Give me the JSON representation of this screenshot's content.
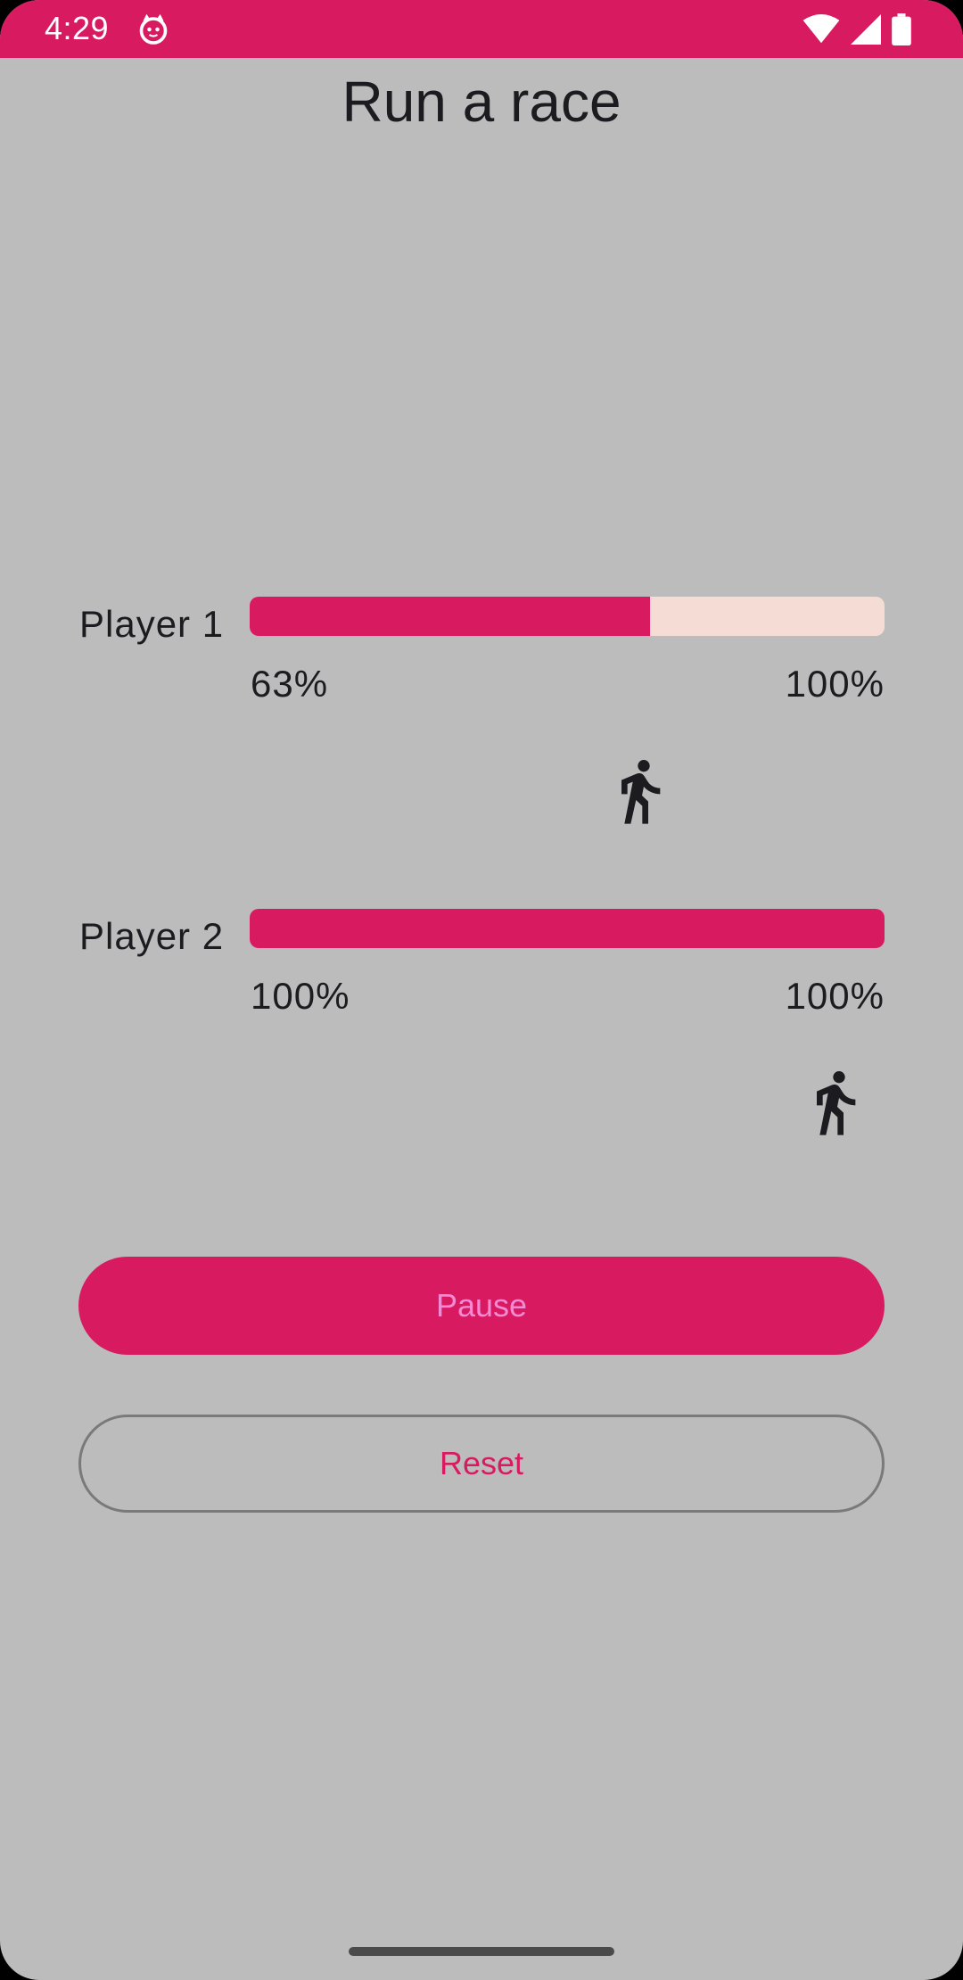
{
  "status_bar": {
    "time": "4:29",
    "icons": [
      "cat-icon",
      "wifi-icon",
      "cell-signal-icon",
      "battery-icon"
    ],
    "color": "#d81b60"
  },
  "title": "Run a race",
  "players": [
    {
      "label": "Player 1",
      "progress_label": "63%",
      "max_label": "100%",
      "progress": 0.63
    },
    {
      "label": "Player 2",
      "progress_label": "100%",
      "max_label": "100%",
      "progress": 1.0
    }
  ],
  "buttons": {
    "pause": "Pause",
    "reset": "Reset"
  },
  "colors": {
    "accent": "#d81b60",
    "track": "#f5ddd6",
    "background": "#bcbcbc",
    "pause_text": "#f28ad6"
  }
}
